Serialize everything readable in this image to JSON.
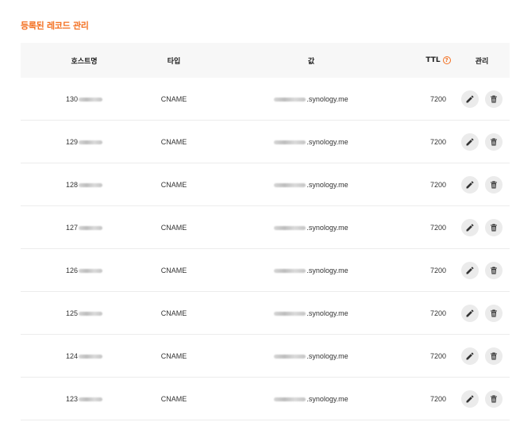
{
  "section": {
    "title": "등록된 레코드 관리"
  },
  "table": {
    "headers": {
      "host": "호스트명",
      "type": "타입",
      "value": "값",
      "ttl": "TTL",
      "manage": "관리"
    },
    "rows": [
      {
        "host": "130",
        "type": "CNAME",
        "value": ".synology.me",
        "ttl": "7200"
      },
      {
        "host": "129",
        "type": "CNAME",
        "value": ".synology.me",
        "ttl": "7200"
      },
      {
        "host": "128",
        "type": "CNAME",
        "value": ".synology.me",
        "ttl": "7200"
      },
      {
        "host": "127",
        "type": "CNAME",
        "value": ".synology.me",
        "ttl": "7200"
      },
      {
        "host": "126",
        "type": "CNAME",
        "value": ".synology.me",
        "ttl": "7200"
      },
      {
        "host": "125",
        "type": "CNAME",
        "value": ".synology.me",
        "ttl": "7200"
      },
      {
        "host": "124",
        "type": "CNAME",
        "value": ".synology.me",
        "ttl": "7200"
      },
      {
        "host": "123",
        "type": "CNAME",
        "value": ".synology.me",
        "ttl": "7200"
      }
    ]
  },
  "icons": {
    "ttl_help": "help-icon",
    "edit": "pencil-icon",
    "delete": "trash-icon"
  },
  "colors": {
    "accent": "#f37021",
    "header_bg": "#f7f7f7",
    "icon_bg": "#ebebeb"
  }
}
